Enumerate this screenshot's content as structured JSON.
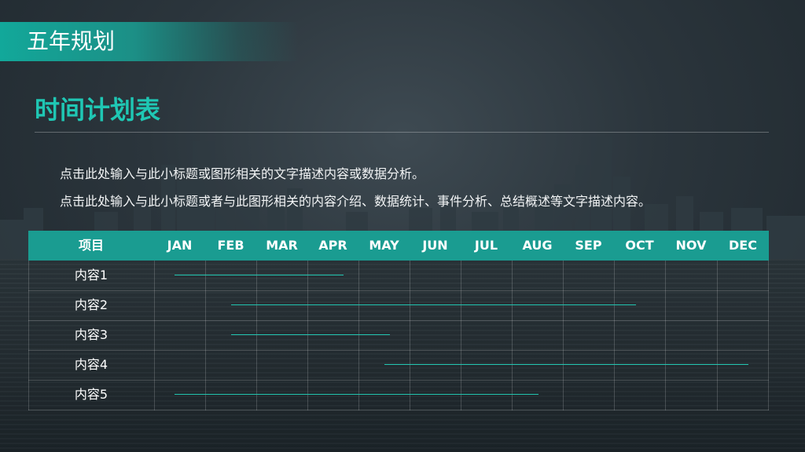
{
  "header": {
    "title": "五年规划"
  },
  "section": {
    "title": "时间计划表"
  },
  "description": {
    "line1": "点击此处输入与此小标题或图形相关的文字描述内容或数据分析。",
    "line2": "点击此处输入与此小标题或者与此图形相关的内容介绍、数据统计、事件分析、总结概述等文字描述内容。"
  },
  "table": {
    "item_header": "项目",
    "months": [
      "JAN",
      "FEB",
      "MAR",
      "APR",
      "MAY",
      "JUN",
      "JUL",
      "AUG",
      "SEP",
      "OCT",
      "NOV",
      "DEC"
    ],
    "rows": [
      {
        "label": "内容1",
        "start_month": 0.4,
        "end_month": 3.7
      },
      {
        "label": "内容2",
        "start_month": 1.5,
        "end_month": 9.4
      },
      {
        "label": "内容3",
        "start_month": 1.5,
        "end_month": 4.6
      },
      {
        "label": "内容4",
        "start_month": 4.5,
        "end_month": 11.6
      },
      {
        "label": "内容5",
        "start_month": 0.4,
        "end_month": 7.5
      }
    ]
  },
  "colors": {
    "accent": "#1fc7b4",
    "header_bg": "#1a9c91",
    "bar": "#22c6b1"
  }
}
